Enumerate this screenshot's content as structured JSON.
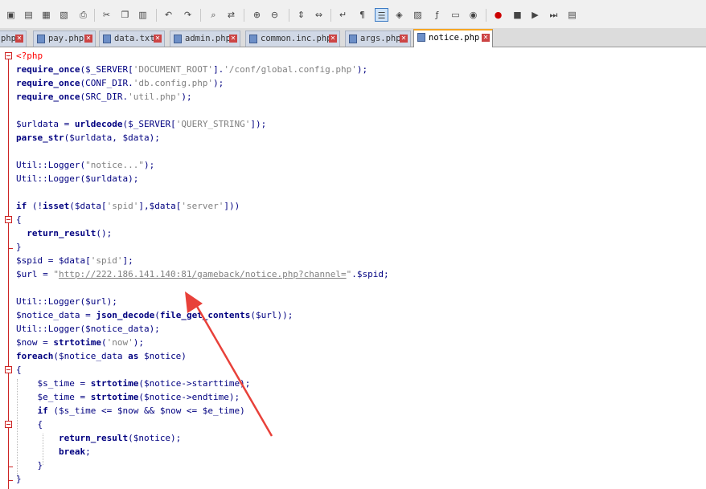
{
  "toolbar": {
    "buttons": [
      {
        "name": "save-icon",
        "glyph": "▣"
      },
      {
        "name": "save-all-icon",
        "glyph": "▤"
      },
      {
        "name": "close-icon",
        "glyph": "▦"
      },
      {
        "name": "close-all-icon",
        "glyph": "▧"
      },
      {
        "name": "print-icon",
        "glyph": "⎙"
      },
      {
        "name": "cut-icon",
        "glyph": "✂"
      },
      {
        "name": "copy-icon",
        "glyph": "❐"
      },
      {
        "name": "paste-icon",
        "glyph": "▥"
      },
      {
        "name": "undo-icon",
        "glyph": "↶"
      },
      {
        "name": "redo-icon",
        "glyph": "↷"
      },
      {
        "name": "find-icon",
        "glyph": "⌕"
      },
      {
        "name": "replace-icon",
        "glyph": "⇄"
      },
      {
        "name": "zoom-in-icon",
        "glyph": "⊕"
      },
      {
        "name": "zoom-out-icon",
        "glyph": "⊖"
      },
      {
        "name": "sync-vertical-icon",
        "glyph": "⇕"
      },
      {
        "name": "sync-horizontal-icon",
        "glyph": "⇔"
      },
      {
        "name": "word-wrap-icon",
        "glyph": "↵"
      },
      {
        "name": "show-all-chars-icon",
        "glyph": "¶"
      },
      {
        "name": "indent-guide-icon",
        "glyph": "☰"
      },
      {
        "name": "user-language-icon",
        "glyph": "◈"
      },
      {
        "name": "doc-map-icon",
        "glyph": "▨"
      },
      {
        "name": "function-list-icon",
        "glyph": "ƒ"
      },
      {
        "name": "folder-workspace-icon",
        "glyph": "▭"
      },
      {
        "name": "monitoring-icon",
        "glyph": "◉"
      },
      {
        "name": "record-macro-icon",
        "glyph": "●"
      },
      {
        "name": "stop-recording-icon",
        "glyph": "■"
      },
      {
        "name": "playback-icon",
        "glyph": "▶"
      },
      {
        "name": "run-macro-multiple-icon",
        "glyph": "⏭"
      },
      {
        "name": "save-macro-icon",
        "glyph": "▤"
      }
    ]
  },
  "tabs": [
    {
      "label": "php"
    },
    {
      "label": "pay.php"
    },
    {
      "label": "data.txt"
    },
    {
      "label": "admin.php"
    },
    {
      "label": "common.inc.php"
    },
    {
      "label": "args.php"
    },
    {
      "label": "notice.php"
    }
  ],
  "code": {
    "l1_open_tag": "<?php",
    "l2_fn": "require_once",
    "l2_a": "($_SERVER[",
    "l2_s1": "'DOCUMENT_ROOT'",
    "l2_b": "].",
    "l2_s2": "'/conf/global.config.php'",
    "l2_c": ");",
    "l3_fn": "require_once",
    "l3_a": "(CONF_DIR.",
    "l3_s1": "'db.config.php'",
    "l3_c": ");",
    "l4_fn": "require_once",
    "l4_a": "(SRC_DIR.",
    "l4_s1": "'util.php'",
    "l4_c": ");",
    "l6_a": "$urldata = ",
    "l6_fn": "urldecode",
    "l6_b": "($_SERVER[",
    "l6_s1": "'QUERY_STRING'",
    "l6_c": "]);",
    "l7_fn": "parse_str",
    "l7_a": "($urldata, $data);",
    "l9_a": "Util::Logger(",
    "l9_s1": "\"notice...\"",
    "l9_c": ");",
    "l10_a": "Util::Logger($urldata);",
    "l12_kw1": "if",
    "l12_a": " (!",
    "l12_kw2": "isset",
    "l12_b": "($data[",
    "l12_s1": "'spid'",
    "l12_c": "],$data[",
    "l12_s2": "'server'",
    "l12_d": "]))",
    "l13_a": "{",
    "l14_fn": "return_result",
    "l14_a": "();",
    "l15_a": "}",
    "l16_a": "$spid = $data[",
    "l16_s1": "'spid'",
    "l16_c": "];",
    "l17_a": "$url = ",
    "l17_q1": "\"",
    "l17_url": "http://222.186.141.140:81/gameback/notice.php?channel=",
    "l17_q2": "\"",
    "l17_c": ".$spid;",
    "l19_a": "Util::Logger($url);",
    "l20_a": "$notice_data = ",
    "l20_fn1": "json_decode",
    "l20_b": "(",
    "l20_fn2": "file_get_contents",
    "l20_c": "($url));",
    "l21_a": "Util::Logger($notice_data);",
    "l22_a": "$now = ",
    "l22_fn": "strtotime",
    "l22_b": "(",
    "l22_s1": "'now'",
    "l22_c": ");",
    "l23_kw1": "foreach",
    "l23_a": "($notice_data ",
    "l23_kw2": "as",
    "l23_b": " $notice)",
    "l24_a": "{",
    "l25_a": "$s_time = ",
    "l25_fn": "strtotime",
    "l25_b": "($notice->starttime);",
    "l26_a": "$e_time = ",
    "l26_fn": "strtotime",
    "l26_b": "($notice->endtime);",
    "l27_kw": "if",
    "l27_a": " ($s_time <= $now && $now <= $e_time)",
    "l28_a": "{",
    "l29_fn": "return_result",
    "l29_a": "($notice);",
    "l30_kw": "break",
    "l30_a": ";",
    "l31_a": "}",
    "l32_a": "}"
  },
  "annotation": {
    "arrow_color": "#e8413a"
  }
}
